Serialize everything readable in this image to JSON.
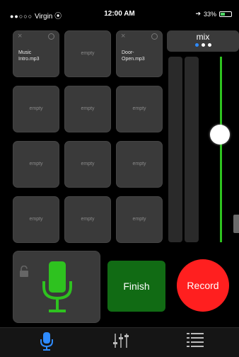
{
  "status_bar": {
    "signal": "●●○○○",
    "carrier": "Virgin",
    "wifi": "⦿",
    "time": "12:00 AM",
    "battery_text": "33%",
    "location": "➔"
  },
  "pads": [
    {
      "label": "Music\nIntro.mp3",
      "loaded": true
    },
    {
      "label": "empty",
      "loaded": false
    },
    {
      "label": "Door-\nOpen.mp3",
      "loaded": true
    },
    {
      "label": "empty",
      "loaded": false
    },
    {
      "label": "empty",
      "loaded": false
    },
    {
      "label": "empty",
      "loaded": false
    },
    {
      "label": "empty",
      "loaded": false
    },
    {
      "label": "empty",
      "loaded": false
    },
    {
      "label": "empty",
      "loaded": false
    },
    {
      "label": "empty",
      "loaded": false
    },
    {
      "label": "empty",
      "loaded": false
    },
    {
      "label": "empty",
      "loaded": false
    }
  ],
  "mix": {
    "title": "mix",
    "page_count": 3,
    "active_page": 0,
    "fader_level": 0.58
  },
  "controls": {
    "finish_label": "Finish",
    "record_label": "Record"
  },
  "tabs": [
    {
      "icon": "microphone-icon",
      "label": "",
      "active": true
    },
    {
      "icon": "mixer-sliders-icon",
      "label": "",
      "active": false
    },
    {
      "icon": "list-icon",
      "label": "",
      "active": false
    }
  ],
  "colors": {
    "accent_blue": "#2e8bff",
    "mic_green": "#2ec21f",
    "finish_green": "#116b14",
    "record_red": "#ff1f1f"
  }
}
